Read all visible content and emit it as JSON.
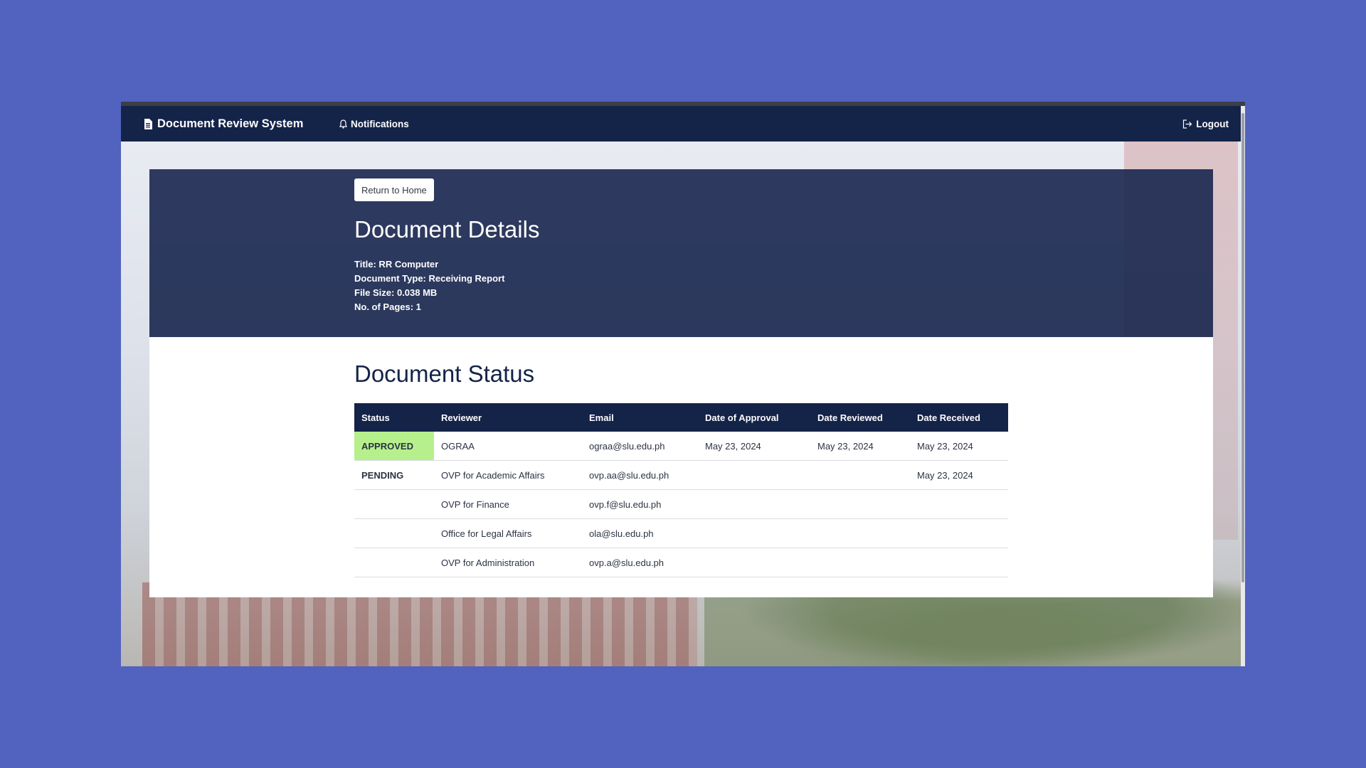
{
  "navbar": {
    "brand_label": "Document Review System",
    "brand_icon": "document-icon",
    "notifications_label": "Notifications",
    "notifications_icon": "bell-icon",
    "logout_label": "Logout",
    "logout_icon": "logout-icon"
  },
  "hero": {
    "return_button_label": "Return to Home",
    "title": "Document Details",
    "meta": {
      "title_line": "Title: RR Computer",
      "type_line": "Document Type: Receiving Report",
      "size_line": "File Size: 0.038 MB",
      "pages_line": "No. of Pages: 1"
    }
  },
  "status_section": {
    "title": "Document Status",
    "columns": [
      "Status",
      "Reviewer",
      "Email",
      "Date of Approval",
      "Date Reviewed",
      "Date Received"
    ],
    "rows": [
      {
        "status": "APPROVED",
        "reviewer": "OGRAA",
        "email": "ograa@slu.edu.ph",
        "date_of_approval": "May 23, 2024",
        "date_reviewed": "May 23, 2024",
        "date_received": "May 23, 2024"
      },
      {
        "status": "PENDING",
        "reviewer": "OVP for Academic Affairs",
        "email": "ovp.aa@slu.edu.ph",
        "date_of_approval": "",
        "date_reviewed": "",
        "date_received": "May 23, 2024"
      },
      {
        "status": "",
        "reviewer": "OVP for Finance",
        "email": "ovp.f@slu.edu.ph",
        "date_of_approval": "",
        "date_reviewed": "",
        "date_received": ""
      },
      {
        "status": "",
        "reviewer": "Office for Legal Affairs",
        "email": "ola@slu.edu.ph",
        "date_of_approval": "",
        "date_reviewed": "",
        "date_received": ""
      },
      {
        "status": "",
        "reviewer": "OVP for Administration",
        "email": "ovp.a@slu.edu.ph",
        "date_of_approval": "",
        "date_reviewed": "",
        "date_received": ""
      }
    ]
  },
  "colors": {
    "page_background": "#5262bf",
    "navbar": "#142348",
    "hero": "#18264e",
    "approved_status": "#b6f08d"
  }
}
